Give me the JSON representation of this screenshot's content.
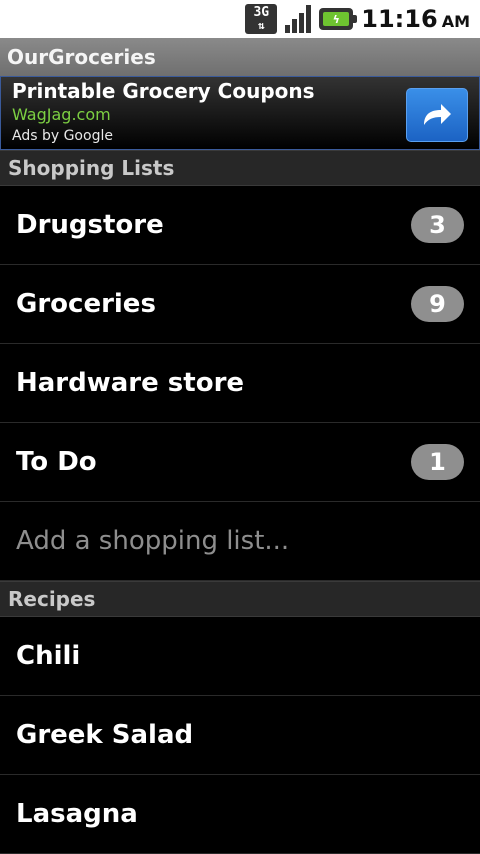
{
  "status": {
    "network": "3G",
    "time": "11:16",
    "ampm": "AM"
  },
  "app": {
    "title": "OurGroceries"
  },
  "ad": {
    "title": "Printable Grocery Coupons",
    "url": "WagJag.com",
    "by": "Ads by Google"
  },
  "shopping": {
    "header": "Shopping Lists",
    "lists": [
      {
        "label": "Drugstore",
        "count": "3"
      },
      {
        "label": "Groceries",
        "count": "9"
      },
      {
        "label": "Hardware store",
        "count": ""
      },
      {
        "label": "To Do",
        "count": "1"
      }
    ],
    "add_placeholder": "Add a shopping list..."
  },
  "recipes": {
    "header": "Recipes",
    "items": [
      {
        "label": "Chili"
      },
      {
        "label": "Greek Salad"
      },
      {
        "label": "Lasagna"
      }
    ]
  }
}
